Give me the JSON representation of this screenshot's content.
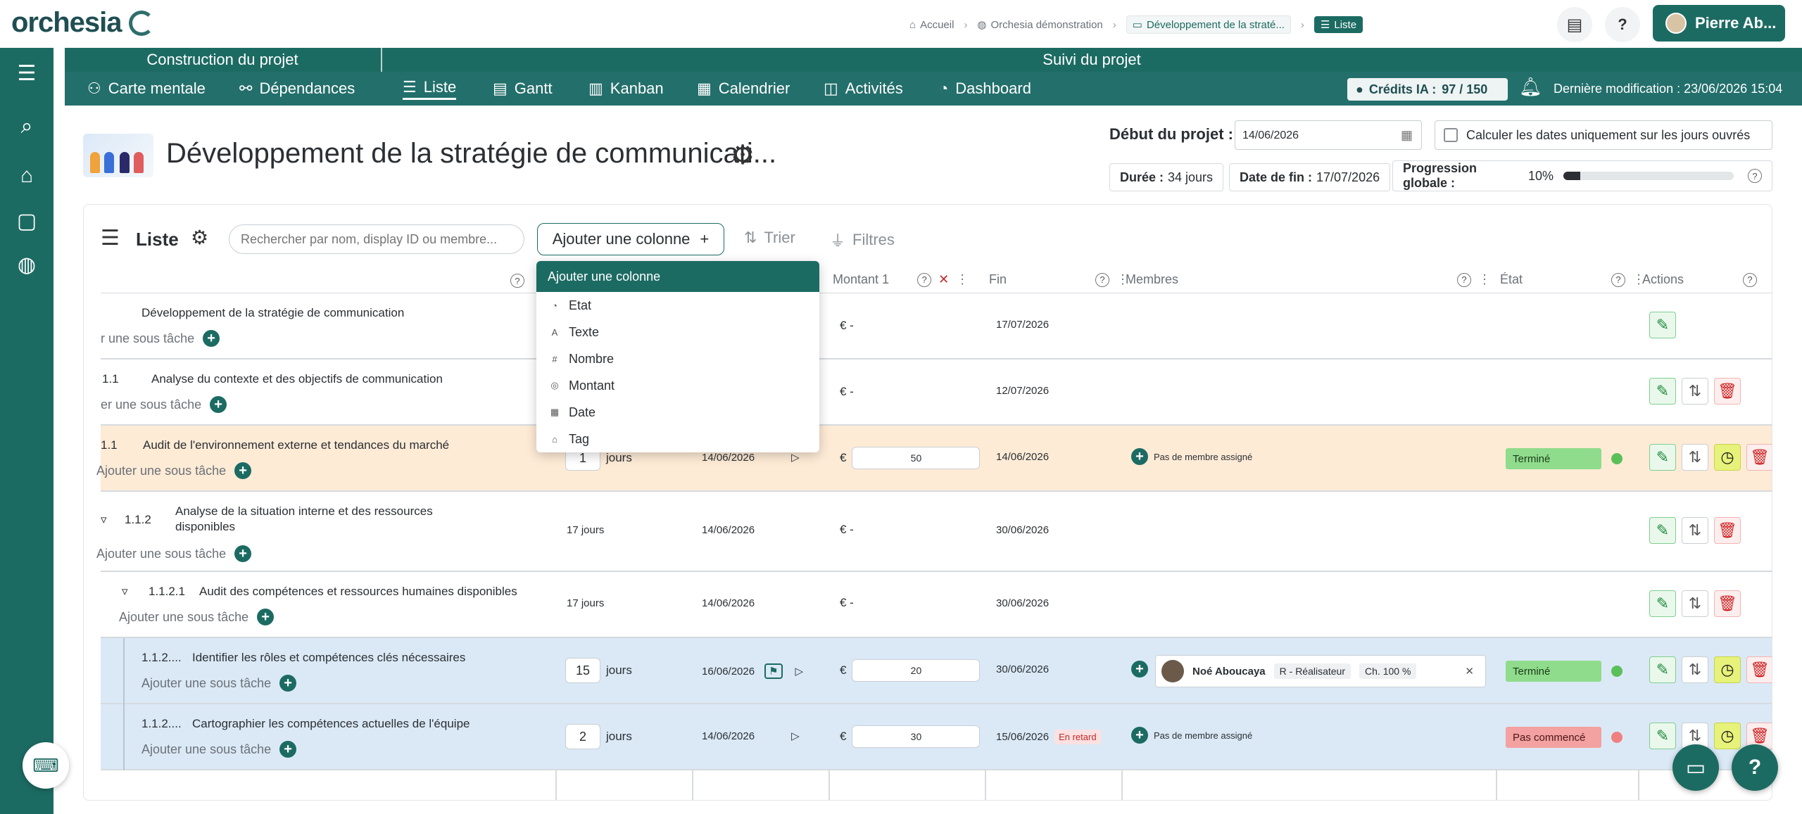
{
  "app": {
    "logo_text": "orchesia",
    "user_name": "Pierre Ab..."
  },
  "breadcrumb": [
    {
      "label": "Accueil",
      "icon": "home-icon"
    },
    {
      "label": "Orchesia démonstration",
      "icon": "globe-icon"
    },
    {
      "label": "Développement de la straté...",
      "icon": "folder-icon"
    },
    {
      "label": "Liste",
      "icon": "list-icon"
    }
  ],
  "nav": {
    "group1": "Construction du projet",
    "group2": "Suivi du projet",
    "items": [
      {
        "label": "Carte mentale",
        "icon": "mindmap-icon"
      },
      {
        "label": "Dépendances",
        "icon": "dependencies-icon"
      },
      {
        "label": "Liste",
        "icon": "list-icon",
        "active": true
      },
      {
        "label": "Gantt",
        "icon": "gantt-icon"
      },
      {
        "label": "Kanban",
        "icon": "kanban-icon"
      },
      {
        "label": "Calendrier",
        "icon": "calendar-icon"
      },
      {
        "label": "Activités",
        "icon": "activity-icon"
      },
      {
        "label": "Dashboard",
        "icon": "dashboard-icon"
      }
    ],
    "credits_label": "Crédits IA :",
    "credits_value": "97 / 150",
    "last_modified_label": "Dernière modification :",
    "last_modified_value": "23/06/2026 15:04"
  },
  "project": {
    "title": "Développement de la stratégie de communicati...",
    "start_label": "Début du projet :",
    "start_value": "14/06/2026",
    "workdays_label": "Calculer les dates uniquement sur les jours ouvrés",
    "duration_label": "Durée :",
    "duration_value": "34 jours",
    "end_label": "Date de fin :",
    "end_value": "17/07/2026",
    "progress_label": "Progression globale :",
    "progress_value": "10%",
    "progress_fraction": 0.1
  },
  "list": {
    "title": "Liste",
    "search_placeholder": "Rechercher par nom, display ID ou membre...",
    "add_column": "Ajouter une colonne",
    "sort": "Trier",
    "filters": "Filtres",
    "columns": {
      "montant": "Montant 1",
      "fin": "Fin",
      "membres": "Membres",
      "etat": "État",
      "actions": "Actions"
    },
    "add_subtask": "Ajouter une sous tâche",
    "no_member": "Pas de membre assigné",
    "days_unit": "jours",
    "currency": "€"
  },
  "dropdown": {
    "title": "Ajouter une colonne",
    "items": [
      {
        "label": "Etat",
        "icon": "state-icon"
      },
      {
        "label": "Texte",
        "icon": "text-icon"
      },
      {
        "label": "Nombre",
        "icon": "number-icon"
      },
      {
        "label": "Montant",
        "icon": "amount-icon"
      },
      {
        "label": "Date",
        "icon": "date-icon"
      },
      {
        "label": "Tag",
        "icon": "tag-icon"
      }
    ]
  },
  "rows": [
    {
      "id": "",
      "name": "Développement de la stratégie de communication",
      "add": "r une sous tâche",
      "amount": "€ -",
      "end": "17/07/2026"
    },
    {
      "id": "1.1",
      "name": "Analyse du contexte et des objectifs de communication",
      "add": "er une sous tâche",
      "amount": "€ -",
      "end": "12/07/2026"
    },
    {
      "id": "1.1",
      "name": "Audit de l'environnement externe et tendances du marché",
      "add": "Ajouter une sous tâche",
      "duration": "1",
      "start": "14/06/2026",
      "amount_value": "50",
      "end": "14/06/2026",
      "state": "Terminé"
    },
    {
      "id": "1.1.2",
      "name1": "Analyse de la situation interne et des ressources",
      "name2": "disponibles",
      "add": "Ajouter une sous tâche",
      "duration_text": "17 jours",
      "start": "14/06/2026",
      "amount": "€ -",
      "end": "30/06/2026"
    },
    {
      "id": "1.1.2.1",
      "name": "Audit des compétences et ressources humaines disponibles",
      "add": "Ajouter une sous tâche",
      "duration_text": "17 jours",
      "start": "14/06/2026",
      "amount": "€ -",
      "end": "30/06/2026"
    },
    {
      "id": "1.1.2....",
      "name": "Identifier les rôles et compétences clés nécessaires",
      "add": "Ajouter une sous tâche",
      "duration": "15",
      "start": "16/06/2026",
      "amount_value": "20",
      "end": "30/06/2026",
      "member": "Noé Aboucaya",
      "role": "R - Réalisateur",
      "charge": "Ch. 100 %",
      "state": "Terminé"
    },
    {
      "id": "1.1.2....",
      "name": "Cartographier les compétences actuelles de l'équipe",
      "add": "Ajouter une sous tâche",
      "duration": "2",
      "start": "14/06/2026",
      "amount_value": "30",
      "end": "15/06/2026",
      "late": "En retard",
      "state": "Pas commencé"
    }
  ],
  "colors": {
    "primary": "#1c6b63",
    "done": "#8fdc8c",
    "not_started": "#f3a1a1",
    "orange_row": "#fdebd6",
    "blue_row": "#dbe9f6"
  }
}
